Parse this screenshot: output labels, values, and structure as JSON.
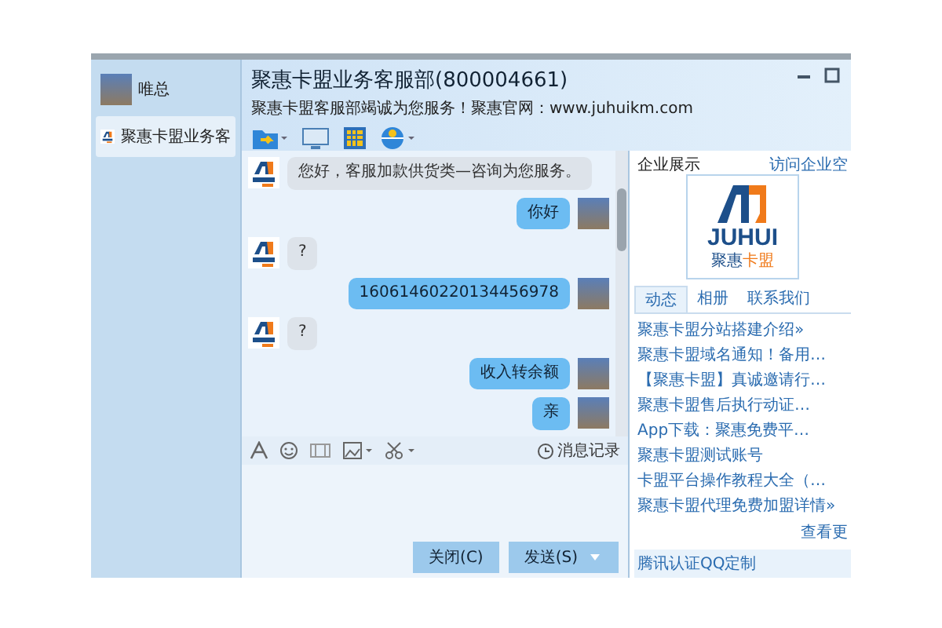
{
  "sidebar": {
    "items": [
      {
        "label": "唯总",
        "kind": "photo",
        "selected": false
      },
      {
        "label": "聚惠卡盟业务客",
        "kind": "logo",
        "selected": true
      }
    ]
  },
  "header": {
    "title": "聚惠卡盟业务客服部(800004661)",
    "subtitle": "聚惠卡盟客服部竭诚为您服务！聚惠官网：www.juhuikm.com"
  },
  "chat": {
    "messages": [
      {
        "kind": "in",
        "text": "您好，客服加款供货类—咨询为您服务。"
      },
      {
        "kind": "out",
        "text": "你好"
      },
      {
        "kind": "in",
        "text": "?"
      },
      {
        "kind": "out",
        "text": "16061460220134456978"
      },
      {
        "kind": "in",
        "text": "?"
      },
      {
        "kind": "out",
        "text": "收入转余额"
      },
      {
        "kind": "out",
        "text": "亲"
      }
    ]
  },
  "input_toolbar": {
    "history": "消息记录"
  },
  "buttons": [
    {
      "label": "关闭(C)",
      "dropdown": false
    },
    {
      "label": "发送(S)",
      "dropdown": true
    }
  ],
  "company": {
    "title": "企业展示",
    "link": "访问企业空",
    "logo": {
      "wordmark": "JUHUI",
      "tagline": "聚惠",
      "tagline_accent": "卡盟"
    },
    "tabs": [
      {
        "label": "动态",
        "selected": true
      },
      {
        "label": "相册",
        "selected": false
      },
      {
        "label": "联系我们",
        "selected": false
      }
    ],
    "news": [
      "聚惠卡盟分站搭建介绍»",
      "聚惠卡盟域名通知！备用…",
      "【聚惠卡盟】真诚邀请行…",
      "聚惠卡盟售后执行动证…",
      "App下载：聚惠免费平…",
      "聚惠卡盟测试账号",
      "卡盟平台操作教程大全（…",
      "聚惠卡盟代理免费加盟详情»"
    ],
    "more": "查看更",
    "footer": "腾讯认证QQ定制"
  }
}
